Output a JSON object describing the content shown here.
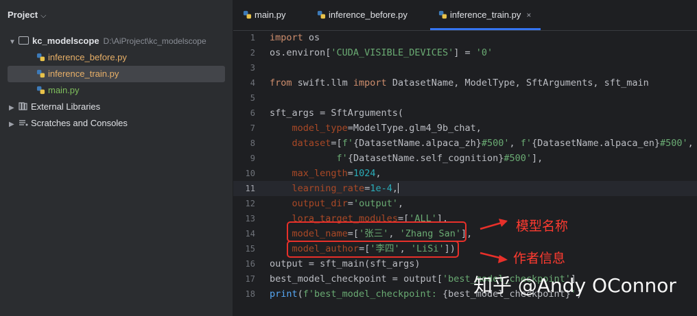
{
  "project": {
    "header": "Project",
    "root": {
      "name": "kc_modelscope",
      "path": "D:\\AiProject\\kc_modelscope"
    },
    "files": [
      {
        "name": "inference_before.py",
        "color": "orange"
      },
      {
        "name": "inference_train.py",
        "color": "orange",
        "selected": true
      },
      {
        "name": "main.py",
        "color": "green"
      }
    ],
    "external_libraries": "External Libraries",
    "scratches": "Scratches and Consoles"
  },
  "tabs": [
    {
      "label": "main.py"
    },
    {
      "label": "inference_before.py"
    },
    {
      "label": "inference_train.py",
      "active": true,
      "close": "×"
    }
  ],
  "editor": {
    "current_line": 11,
    "lines": [
      "1",
      "2",
      "3",
      "4",
      "5",
      "6",
      "7",
      "8",
      "9",
      "10",
      "11",
      "12",
      "13",
      "14",
      "15",
      "16",
      "17",
      "18"
    ],
    "code": {
      "l1_kw": "import",
      "l1_rest": " os",
      "l2_a": "os.environ[",
      "l2_s": "'CUDA_VISIBLE_DEVICES'",
      "l2_b": "] = ",
      "l2_s2": "'0'",
      "l4_kw1": "from",
      "l4_a": " swift.llm ",
      "l4_kw2": "import",
      "l4_b": " DatasetName, ModelType, SftArguments, sft_main",
      "l6": "sft_args = SftArguments(",
      "l7_p": "model_type",
      "l7_r": "=ModelType.glm4_9b_chat,",
      "l8_p": "dataset",
      "l8_a": "=[",
      "l8_s1": "f'",
      "l8_b": "{DatasetName.alpaca_zh}",
      "l8_s2": "#500'",
      "l8_c": ", ",
      "l8_s3": "f'",
      "l8_d": "{DatasetName.alpaca_en}",
      "l8_s4": "#500'",
      "l8_e": ",",
      "l9_s1": "f'",
      "l9_a": "{DatasetName.self_cognition}",
      "l9_s2": "#500'",
      "l9_b": "],",
      "l10_p": "max_length",
      "l10_a": "=",
      "l10_n": "1024",
      "l10_b": ",",
      "l11_p": "learning_rate",
      "l11_a": "=",
      "l11_n": "1e-4",
      "l11_b": ",",
      "l12_p": "output_dir",
      "l12_a": "=",
      "l12_s": "'output'",
      "l12_b": ",",
      "l13_p": "lora_target_modules",
      "l13_a": "=[",
      "l13_s": "'ALL'",
      "l13_b": "],",
      "l14_p": "model_name",
      "l14_a": "=[",
      "l14_s1": "'张三'",
      "l14_b": ", ",
      "l14_s2": "'Zhang San'",
      "l14_c": "],",
      "l15_p": "model_author",
      "l15_a": "=[",
      "l15_s1": "'李四'",
      "l15_b": ", ",
      "l15_s2": "'LiSi'",
      "l15_c": "])",
      "l16": "output = sft_main(sft_args)",
      "l17_a": "best_model_checkpoint = output[",
      "l17_s": "'best_model_checkpoint'",
      "l17_b": "]",
      "l18_f": "print",
      "l18_a": "(",
      "l18_s1": "f'best_model_checkpoint: ",
      "l18_b": "{best_model_checkpoint}",
      "l18_s2": "'",
      "l18_c": ")"
    }
  },
  "annotations": {
    "model_name": "模型名称",
    "author_info": "作者信息"
  },
  "watermark": "知乎 @Andy OConnor",
  "colors": {
    "accent": "#3574f0",
    "annotation_red": "#e8302a",
    "keyword": "#cf8e6d",
    "string": "#6aab73",
    "number": "#2aacb8",
    "param": "#aa4926"
  },
  "icons": {
    "python": "python-file-icon",
    "folder": "folder-icon",
    "library": "library-icon",
    "scratches": "scratches-icon"
  }
}
